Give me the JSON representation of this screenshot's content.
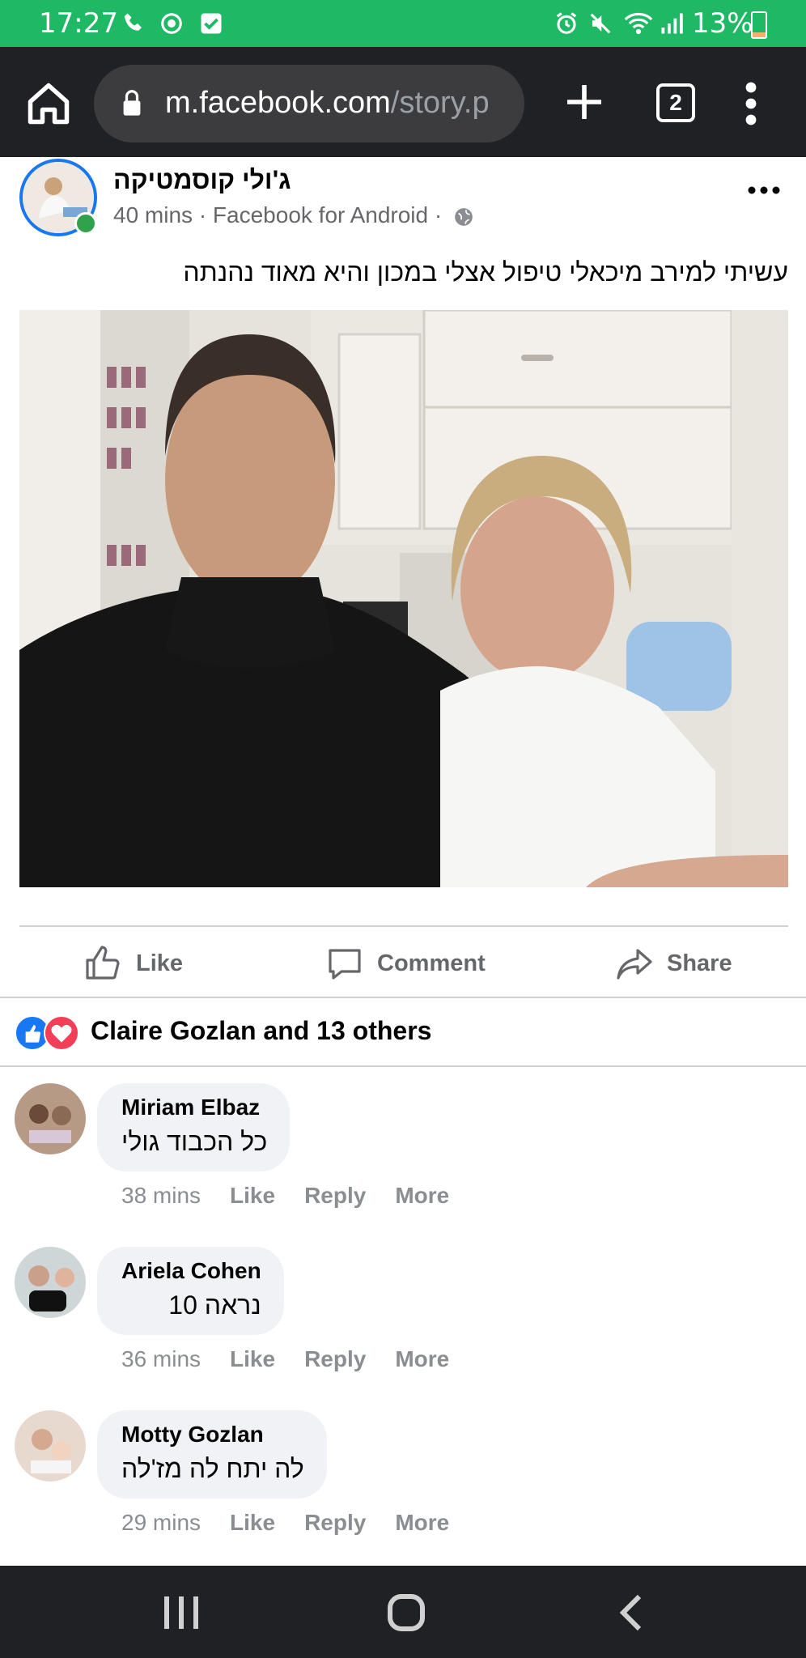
{
  "status_bar": {
    "time": "17:27",
    "battery": "13%",
    "icons": [
      "phone-icon",
      "whatsapp-icon",
      "checkbox-icon",
      "alarm-icon",
      "mute-icon",
      "wifi-icon",
      "signal-icon",
      "battery-icon"
    ]
  },
  "browser": {
    "url_host": "m.facebook.com",
    "url_path": "/story.p",
    "tab_count": "2"
  },
  "post": {
    "author": "ג'ולי קוסמטיקה",
    "meta": "40 mins · Facebook for Android ·",
    "text": "עשיתי למירב מיכאלי טיפול אצלי במכון והיא מאוד נהנתה"
  },
  "actions": {
    "like": "Like",
    "comment": "Comment",
    "share": "Share"
  },
  "reactions": {
    "summary": "Claire Gozlan and 13 others"
  },
  "comments": [
    {
      "name": "Miriam Elbaz",
      "text": "כל הכבוד גולי",
      "time": "38 mins",
      "like": "Like",
      "reply": "Reply",
      "more": "More"
    },
    {
      "name": "Ariela Cohen",
      "text": "נראה 10",
      "time": "36 mins",
      "like": "Like",
      "reply": "Reply",
      "more": "More"
    },
    {
      "name": "Motty Gozlan",
      "text": "לה יתח לה מז'לה",
      "time": "29 mins",
      "like": "Like",
      "reply": "Reply",
      "more": "More"
    }
  ],
  "colors": {
    "status_green": "#1fb865",
    "facebook_blue": "#1877f2",
    "dark_chrome": "#202124"
  }
}
